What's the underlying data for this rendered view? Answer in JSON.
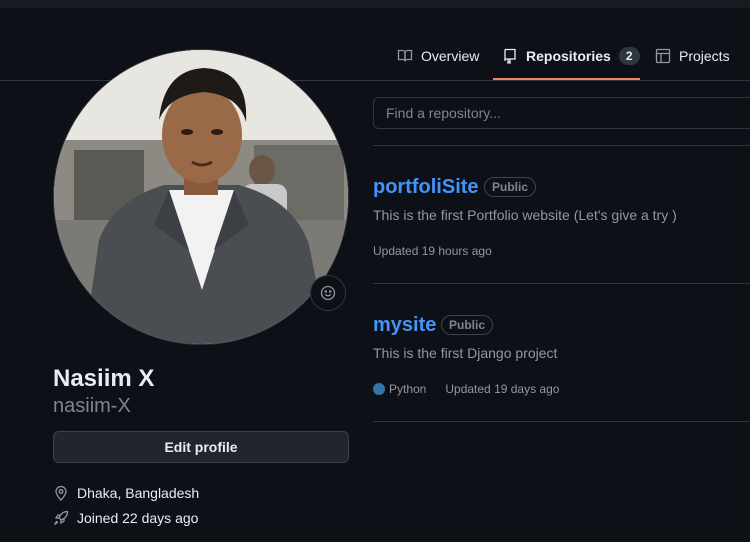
{
  "tabs": {
    "overview": "Overview",
    "repositories": "Repositories",
    "repositories_count": "2",
    "projects": "Projects"
  },
  "profile": {
    "full_name": "Nasiim X",
    "username": "nasiim-X",
    "edit_button": "Edit profile",
    "location": "Dhaka, Bangladesh",
    "joined": "Joined 22 days ago"
  },
  "search": {
    "placeholder": "Find a repository..."
  },
  "repos": [
    {
      "name": "portfoliSite",
      "visibility": "Public",
      "description": "This is the first Portfolio website (Let's give a try )",
      "language": "",
      "updated": "Updated 19 hours ago"
    },
    {
      "name": "mysite",
      "visibility": "Public",
      "description": "This is the first Django project",
      "language": "Python",
      "language_color": "#3572A5",
      "updated": "Updated 19 days ago"
    }
  ],
  "icons": [
    "book-icon",
    "repo-icon",
    "table-icon",
    "smiley-icon",
    "location-icon",
    "rocket-icon"
  ],
  "colors": {
    "accent": "#f78166",
    "link": "#4493f8",
    "background": "#0d1117"
  }
}
